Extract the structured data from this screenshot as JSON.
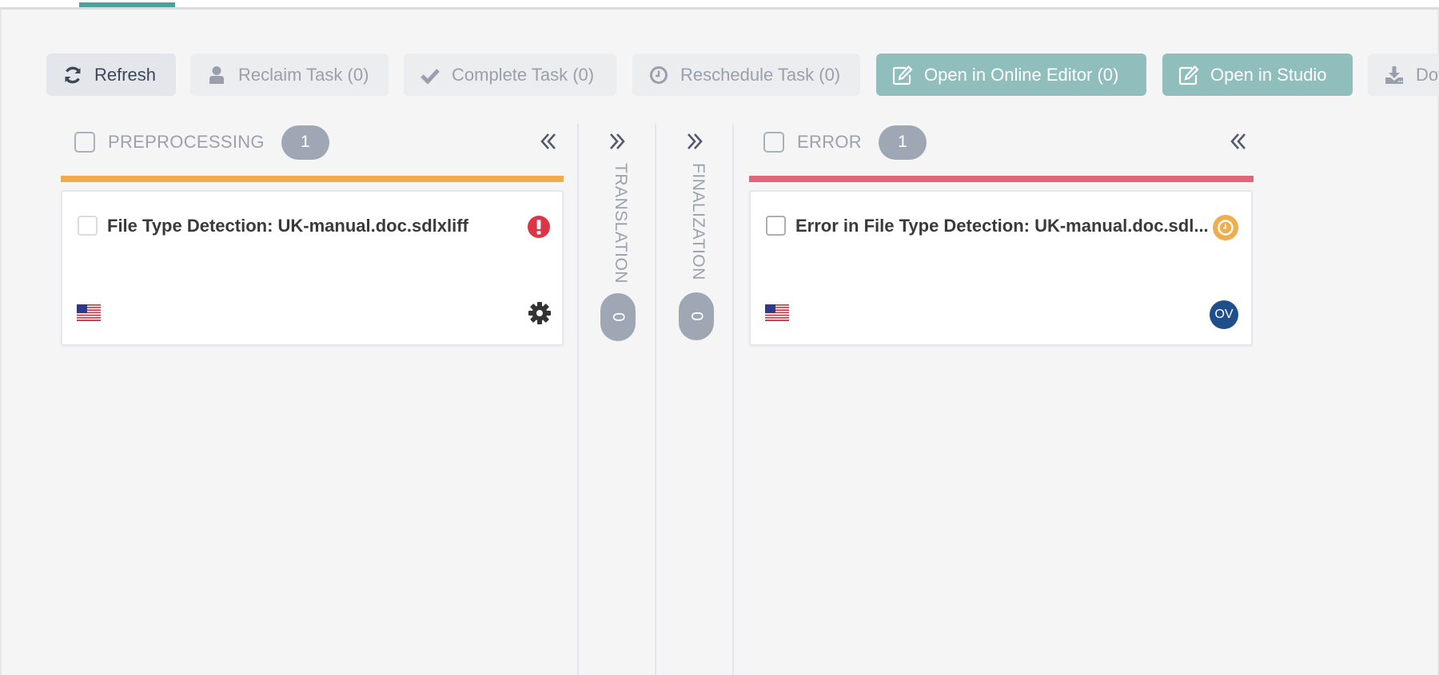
{
  "nav": {
    "active_tab_color": "#4aa39a"
  },
  "toolbar": {
    "refresh": {
      "label": "Refresh",
      "icon": "refresh-icon"
    },
    "reclaim": {
      "label": "Reclaim Task (0)",
      "icon": "user-icon"
    },
    "complete": {
      "label": "Complete Task (0)",
      "icon": "check-icon"
    },
    "reschedule": {
      "label": "Reschedule Task (0)",
      "icon": "clock-icon"
    },
    "online_editor": {
      "label": "Open in Online Editor (0)",
      "icon": "edit-icon"
    },
    "studio": {
      "label": "Open in Studio",
      "icon": "edit-icon"
    },
    "download": {
      "label": "Download",
      "icon": "download-icon"
    }
  },
  "columns": [
    {
      "title": "PREPROCESSING",
      "count": "1",
      "status_color": "#f0ad4e",
      "collapsed": false,
      "cards": [
        {
          "title": "File Type Detection: UK-manual.doc.sdlxliff",
          "status_icon": "exclamation-circle-icon",
          "status_color": "#dc3545",
          "language_flag": "us-flag",
          "bottom_icon": "gear-icon"
        }
      ]
    },
    {
      "title": "TRANSLATION",
      "count": "0",
      "collapsed": true
    },
    {
      "title": "FINALIZATION",
      "count": "0",
      "collapsed": true
    },
    {
      "title": "ERROR",
      "count": "1",
      "status_color": "#e0677a",
      "collapsed": false,
      "cards": [
        {
          "title": "Error in File Type Detection: UK-manual.doc.sdl...",
          "status_icon": "clock-circle-icon",
          "status_color": "#f0ad4e",
          "language_flag": "us-flag",
          "assignee_initials": "OV",
          "assignee_color": "#1f4e8a"
        }
      ]
    }
  ]
}
